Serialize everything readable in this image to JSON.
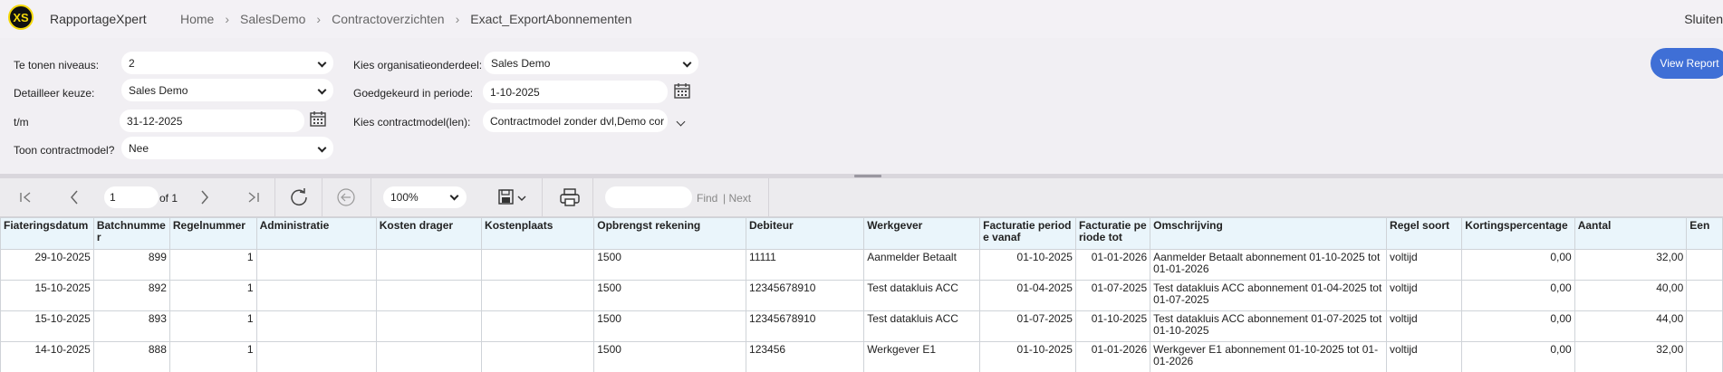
{
  "app": {
    "logo": "XS",
    "name": "RapportageXpert",
    "close_label": "Sluiten"
  },
  "breadcrumb": [
    "Home",
    "SalesDemo",
    "Contractoverzichten",
    "Exact_ExportAbonnementen"
  ],
  "params": {
    "niveaus": {
      "label": "Te tonen niveaus:",
      "value": "2"
    },
    "detailleer": {
      "label": "Detailleer keuze:",
      "value": "Sales Demo"
    },
    "tm": {
      "label": "t/m",
      "value": "31-12-2025"
    },
    "toon_contractmodel": {
      "label": "Toon contractmodel?",
      "value": "Nee"
    },
    "organisatieonderdeel": {
      "label": "Kies organisatieonderdeel:",
      "value": "Sales Demo"
    },
    "goedgekeurd": {
      "label": "Goedgekeurd in periode:",
      "value": "1-10-2025"
    },
    "contractmodel": {
      "label": "Kies contractmodel(len):",
      "value": "Contractmodel zonder dvl,Demo cor"
    },
    "view_report_label": "View Report"
  },
  "toolbar": {
    "page_value": "1",
    "page_of": "of 1",
    "zoom": "100%",
    "find_label": "Find",
    "next_label": "| Next"
  },
  "table": {
    "headers": [
      "Fiateringsdatum",
      "Batchnummer",
      "Regelnummer",
      "Administratie",
      "Kosten drager",
      "Kostenplaats",
      "Opbrengst rekening",
      "Debiteur",
      "Werkgever",
      "Facturatie periode vanaf",
      "Facturatie periode tot",
      "Omschrijving",
      "Regel soort",
      "Kortingspercentage",
      "Aantal",
      "Een"
    ],
    "rows": [
      [
        "29-10-2025",
        "899",
        "1",
        "",
        "",
        "",
        "1500",
        "11111",
        "Aanmelder Betaalt",
        "01-10-2025",
        "01-01-2026",
        "Aanmelder Betaalt abonnement 01-10-2025 tot 01-01-2026",
        "voltijd",
        "0,00",
        "32,00",
        ""
      ],
      [
        "15-10-2025",
        "892",
        "1",
        "",
        "",
        "",
        "1500",
        "12345678910",
        "Test datakluis ACC",
        "01-04-2025",
        "01-07-2025",
        "Test datakluis ACC abonnement 01-04-2025 tot 01-07-2025",
        "voltijd",
        "0,00",
        "40,00",
        ""
      ],
      [
        "15-10-2025",
        "893",
        "1",
        "",
        "",
        "",
        "1500",
        "12345678910",
        "Test datakluis ACC",
        "01-07-2025",
        "01-10-2025",
        "Test datakluis ACC abonnement 01-07-2025 tot 01-10-2025",
        "voltijd",
        "0,00",
        "44,00",
        ""
      ],
      [
        "14-10-2025",
        "888",
        "1",
        "",
        "",
        "",
        "1500",
        "123456",
        "Werkgever E1",
        "01-10-2025",
        "01-01-2026",
        "Werkgever E1 abonnement 01-10-2025 tot 01-01-2026",
        "voltijd",
        "0,00",
        "32,00",
        ""
      ]
    ]
  },
  "colors": {
    "accent": "#3f6fd6",
    "header_bg": "#eaf5fb",
    "logo_yellow": "#f5d90a"
  }
}
